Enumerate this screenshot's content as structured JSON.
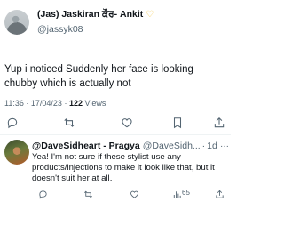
{
  "main_tweet": {
    "display_name": "(Jas) Jaskiran ਕੌਰ- Ankit",
    "emoji_icon": "yellow-heart-icon",
    "handle": "@jassyk08",
    "text": "Yup i noticed Suddenly her face is looking chubby which is actually not",
    "time": "11:36",
    "date": "17/04/23",
    "separator": "·",
    "views_count": "122",
    "views_label": "Views",
    "actions": [
      "reply-icon",
      "retweet-icon",
      "like-icon",
      "bookmark-icon",
      "share-icon"
    ]
  },
  "reply": {
    "display_name": "@DaveSidheart - Pragya",
    "handle": "@DaveSidh...",
    "separator": "·",
    "time": "1d",
    "more": "···",
    "text": "Yea! I'm not sure if these stylist use any products/injections to make it look like that, but it doesn't suit her at all.",
    "views": "65",
    "actions": [
      "reply-icon",
      "retweet-icon",
      "like-icon",
      "views-icon",
      "share-icon"
    ]
  },
  "colors": {
    "text_primary": "#0f1419",
    "text_secondary": "#536471",
    "divider": "#eff3f4",
    "heart": "#f4c542"
  }
}
